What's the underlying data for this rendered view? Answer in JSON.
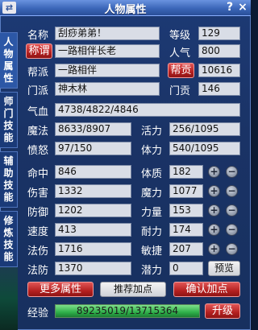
{
  "window": {
    "title": "人物属性",
    "help": "?",
    "close": "×",
    "swap_icon": "swap-icon"
  },
  "side_tabs": [
    {
      "label": "人物属性",
      "active": true
    },
    {
      "label": "师门技能",
      "active": false
    },
    {
      "label": "辅助技能",
      "active": false
    },
    {
      "label": "修炼技能",
      "active": false
    }
  ],
  "profile": {
    "name_label": "名称",
    "name_value": "刮痧弟弟！",
    "level_label": "等级",
    "level_value": "129",
    "title_button": "称谓",
    "title_value": "一路相伴长老",
    "popularity_label": "人气",
    "popularity_value": "800",
    "guild_label": "帮派",
    "guild_value": "一路相伴",
    "contribution_button": "帮贡",
    "contribution_value": "10616",
    "sect_label": "门派",
    "sect_value": "神木林",
    "sect_contribution_label": "门贡",
    "sect_contribution_value": "146"
  },
  "vitals": {
    "hp_label": "气血",
    "hp_value": "4738/4822/4846",
    "mp_label": "魔法",
    "mp_value": "8633/8907",
    "vitality_label": "活力",
    "vitality_value": "256/1095",
    "anger_label": "愤怒",
    "anger_value": "97/150",
    "stamina_label": "体力",
    "stamina_value": "540/1095"
  },
  "combat": [
    {
      "label": "命中",
      "value": "846"
    },
    {
      "label": "伤害",
      "value": "1332"
    },
    {
      "label": "防御",
      "value": "1202"
    },
    {
      "label": "速度",
      "value": "413"
    },
    {
      "label": "法伤",
      "value": "1716"
    },
    {
      "label": "法防",
      "value": "1370"
    }
  ],
  "attributes": [
    {
      "label": "体质",
      "value": "182"
    },
    {
      "label": "魔力",
      "value": "1077"
    },
    {
      "label": "力量",
      "value": "153"
    },
    {
      "label": "耐力",
      "value": "174"
    },
    {
      "label": "敏捷",
      "value": "207"
    }
  ],
  "potential": {
    "label": "潜力",
    "value": "0",
    "preview_button": "预览"
  },
  "buttons": {
    "more": "更多属性",
    "recommend": "推荐加点",
    "confirm": "确认加点",
    "upgrade": "升级"
  },
  "experience": {
    "label": "经验",
    "value": "89235019/13715364",
    "progress": 1.0
  },
  "colors": {
    "accent_red": "#b52121",
    "window_blue": "#1a3366",
    "exp_green": "#2fb04a"
  }
}
